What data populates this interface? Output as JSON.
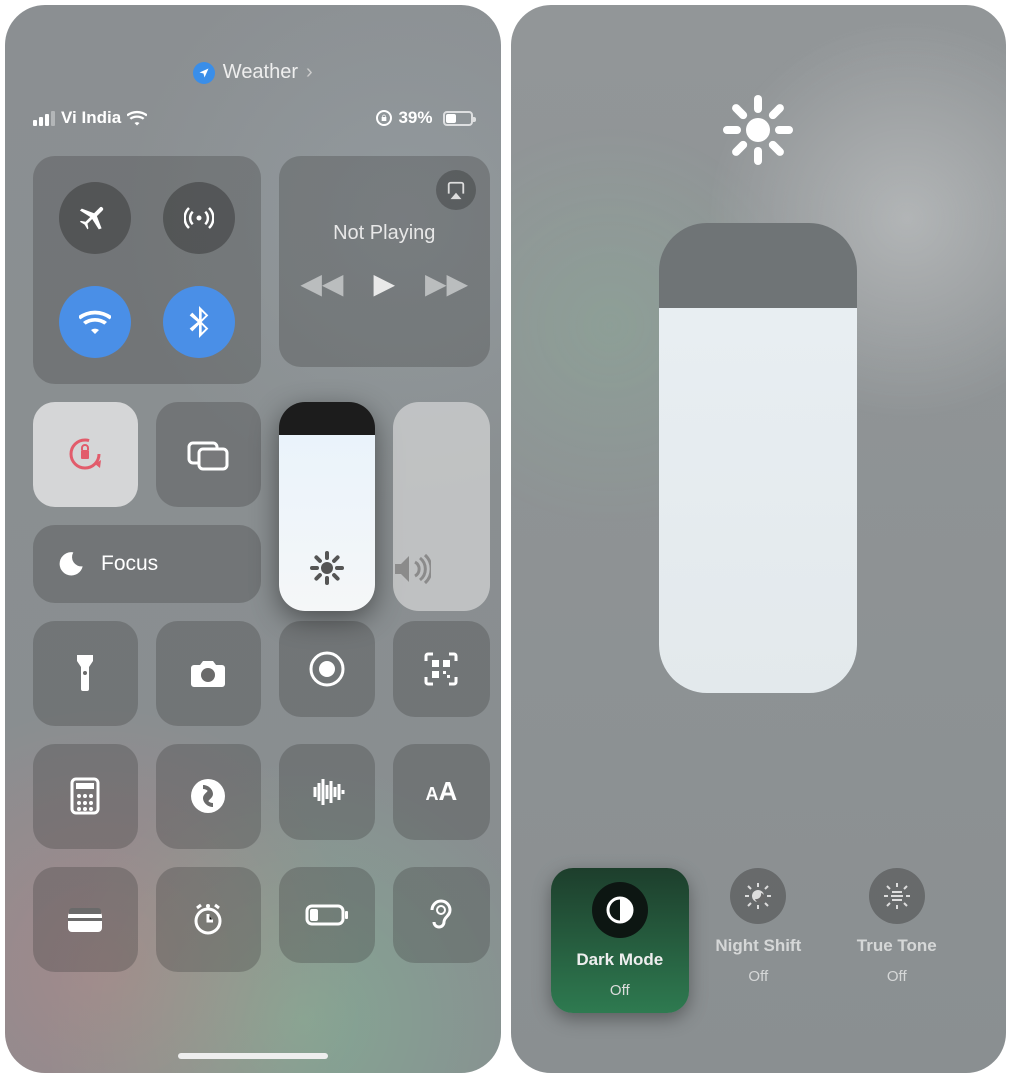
{
  "screen1": {
    "top_app": {
      "name": "Weather"
    },
    "status": {
      "carrier": "Vi India",
      "battery_pct": "39%"
    },
    "media": {
      "title": "Not Playing"
    },
    "focus": {
      "label": "Focus"
    },
    "brightness_pct": 84,
    "volume_pct": 100,
    "toggles": {
      "airplane": false,
      "cellular": false,
      "wifi": true,
      "bluetooth": true,
      "orientation_lock": true
    },
    "quick_icons": [
      "flashlight",
      "camera",
      "screen-record",
      "qr-scanner",
      "calculator",
      "shazam",
      "sound-recognition",
      "text-size",
      "wallet",
      "alarm",
      "low-power",
      "hearing"
    ]
  },
  "screen2": {
    "brightness_pct": 82,
    "options": [
      {
        "key": "dark_mode",
        "label": "Dark Mode",
        "state": "Off",
        "selected": true
      },
      {
        "key": "night_shift",
        "label": "Night Shift",
        "state": "Off",
        "selected": false
      },
      {
        "key": "true_tone",
        "label": "True Tone",
        "state": "Off",
        "selected": false
      }
    ]
  }
}
